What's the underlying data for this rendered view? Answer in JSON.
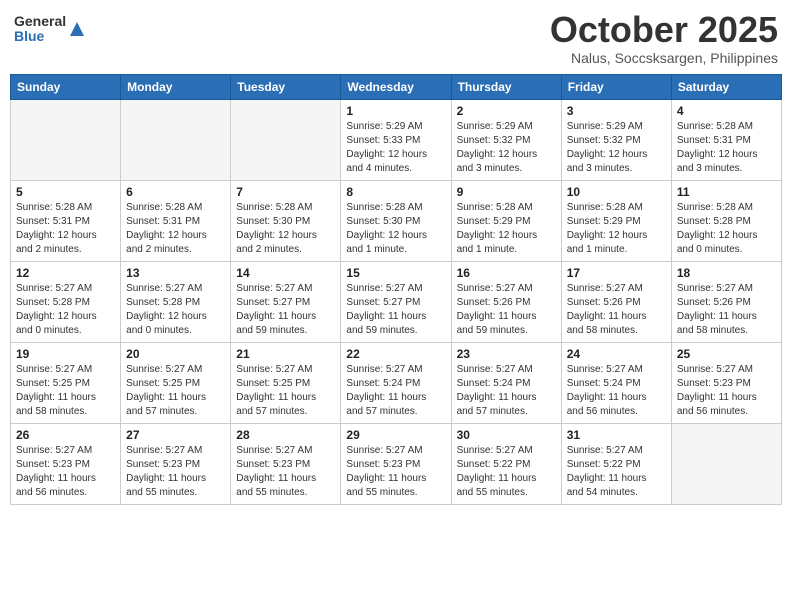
{
  "logo": {
    "general": "General",
    "blue": "Blue"
  },
  "title": "October 2025",
  "location": "Nalus, Soccsksargen, Philippines",
  "days_header": [
    "Sunday",
    "Monday",
    "Tuesday",
    "Wednesday",
    "Thursday",
    "Friday",
    "Saturday"
  ],
  "weeks": [
    [
      {
        "day": "",
        "info": ""
      },
      {
        "day": "",
        "info": ""
      },
      {
        "day": "",
        "info": ""
      },
      {
        "day": "1",
        "info": "Sunrise: 5:29 AM\nSunset: 5:33 PM\nDaylight: 12 hours\nand 4 minutes."
      },
      {
        "day": "2",
        "info": "Sunrise: 5:29 AM\nSunset: 5:32 PM\nDaylight: 12 hours\nand 3 minutes."
      },
      {
        "day": "3",
        "info": "Sunrise: 5:29 AM\nSunset: 5:32 PM\nDaylight: 12 hours\nand 3 minutes."
      },
      {
        "day": "4",
        "info": "Sunrise: 5:28 AM\nSunset: 5:31 PM\nDaylight: 12 hours\nand 3 minutes."
      }
    ],
    [
      {
        "day": "5",
        "info": "Sunrise: 5:28 AM\nSunset: 5:31 PM\nDaylight: 12 hours\nand 2 minutes."
      },
      {
        "day": "6",
        "info": "Sunrise: 5:28 AM\nSunset: 5:31 PM\nDaylight: 12 hours\nand 2 minutes."
      },
      {
        "day": "7",
        "info": "Sunrise: 5:28 AM\nSunset: 5:30 PM\nDaylight: 12 hours\nand 2 minutes."
      },
      {
        "day": "8",
        "info": "Sunrise: 5:28 AM\nSunset: 5:30 PM\nDaylight: 12 hours\nand 1 minute."
      },
      {
        "day": "9",
        "info": "Sunrise: 5:28 AM\nSunset: 5:29 PM\nDaylight: 12 hours\nand 1 minute."
      },
      {
        "day": "10",
        "info": "Sunrise: 5:28 AM\nSunset: 5:29 PM\nDaylight: 12 hours\nand 1 minute."
      },
      {
        "day": "11",
        "info": "Sunrise: 5:28 AM\nSunset: 5:28 PM\nDaylight: 12 hours\nand 0 minutes."
      }
    ],
    [
      {
        "day": "12",
        "info": "Sunrise: 5:27 AM\nSunset: 5:28 PM\nDaylight: 12 hours\nand 0 minutes."
      },
      {
        "day": "13",
        "info": "Sunrise: 5:27 AM\nSunset: 5:28 PM\nDaylight: 12 hours\nand 0 minutes."
      },
      {
        "day": "14",
        "info": "Sunrise: 5:27 AM\nSunset: 5:27 PM\nDaylight: 11 hours\nand 59 minutes."
      },
      {
        "day": "15",
        "info": "Sunrise: 5:27 AM\nSunset: 5:27 PM\nDaylight: 11 hours\nand 59 minutes."
      },
      {
        "day": "16",
        "info": "Sunrise: 5:27 AM\nSunset: 5:26 PM\nDaylight: 11 hours\nand 59 minutes."
      },
      {
        "day": "17",
        "info": "Sunrise: 5:27 AM\nSunset: 5:26 PM\nDaylight: 11 hours\nand 58 minutes."
      },
      {
        "day": "18",
        "info": "Sunrise: 5:27 AM\nSunset: 5:26 PM\nDaylight: 11 hours\nand 58 minutes."
      }
    ],
    [
      {
        "day": "19",
        "info": "Sunrise: 5:27 AM\nSunset: 5:25 PM\nDaylight: 11 hours\nand 58 minutes."
      },
      {
        "day": "20",
        "info": "Sunrise: 5:27 AM\nSunset: 5:25 PM\nDaylight: 11 hours\nand 57 minutes."
      },
      {
        "day": "21",
        "info": "Sunrise: 5:27 AM\nSunset: 5:25 PM\nDaylight: 11 hours\nand 57 minutes."
      },
      {
        "day": "22",
        "info": "Sunrise: 5:27 AM\nSunset: 5:24 PM\nDaylight: 11 hours\nand 57 minutes."
      },
      {
        "day": "23",
        "info": "Sunrise: 5:27 AM\nSunset: 5:24 PM\nDaylight: 11 hours\nand 57 minutes."
      },
      {
        "day": "24",
        "info": "Sunrise: 5:27 AM\nSunset: 5:24 PM\nDaylight: 11 hours\nand 56 minutes."
      },
      {
        "day": "25",
        "info": "Sunrise: 5:27 AM\nSunset: 5:23 PM\nDaylight: 11 hours\nand 56 minutes."
      }
    ],
    [
      {
        "day": "26",
        "info": "Sunrise: 5:27 AM\nSunset: 5:23 PM\nDaylight: 11 hours\nand 56 minutes."
      },
      {
        "day": "27",
        "info": "Sunrise: 5:27 AM\nSunset: 5:23 PM\nDaylight: 11 hours\nand 55 minutes."
      },
      {
        "day": "28",
        "info": "Sunrise: 5:27 AM\nSunset: 5:23 PM\nDaylight: 11 hours\nand 55 minutes."
      },
      {
        "day": "29",
        "info": "Sunrise: 5:27 AM\nSunset: 5:23 PM\nDaylight: 11 hours\nand 55 minutes."
      },
      {
        "day": "30",
        "info": "Sunrise: 5:27 AM\nSunset: 5:22 PM\nDaylight: 11 hours\nand 55 minutes."
      },
      {
        "day": "31",
        "info": "Sunrise: 5:27 AM\nSunset: 5:22 PM\nDaylight: 11 hours\nand 54 minutes."
      },
      {
        "day": "",
        "info": ""
      }
    ]
  ]
}
